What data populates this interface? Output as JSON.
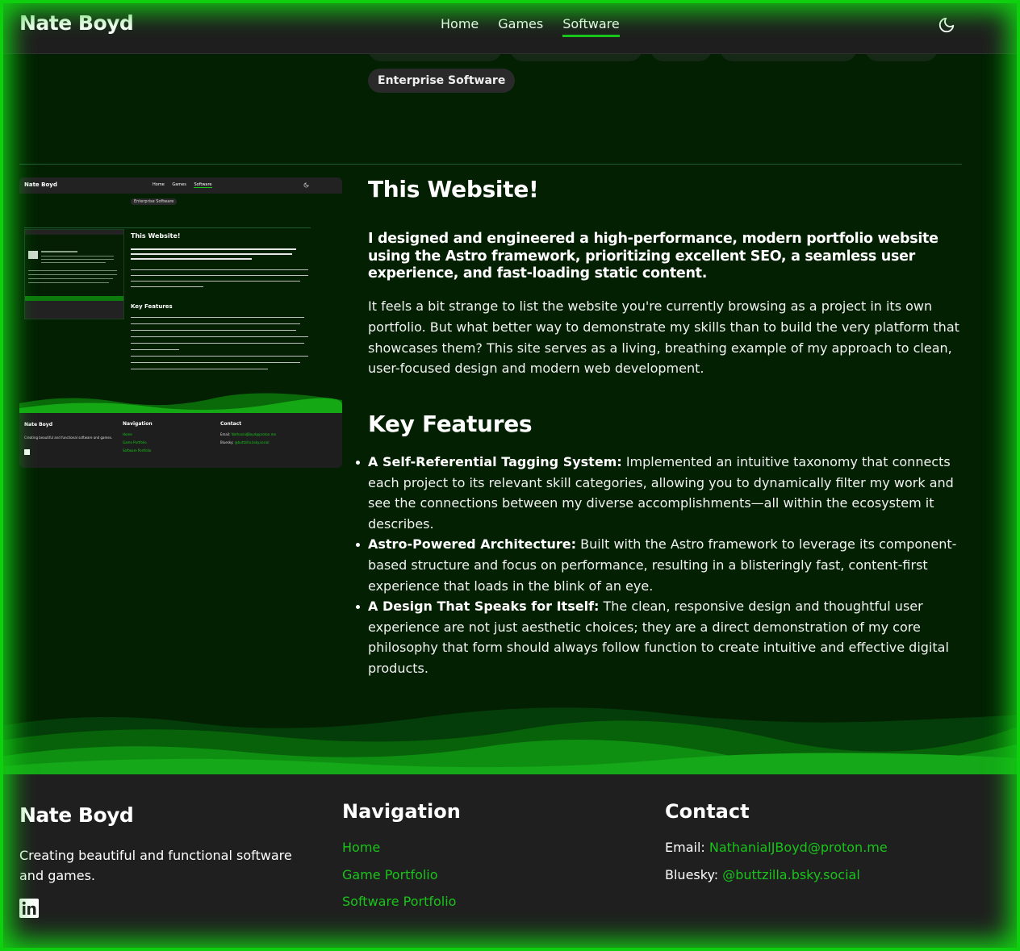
{
  "header": {
    "brand": "Nate Boyd",
    "nav": [
      {
        "label": "Home",
        "active": false
      },
      {
        "label": "Games",
        "active": false
      },
      {
        "label": "Software",
        "active": true
      }
    ],
    "theme_icon": "moon-icon"
  },
  "tags": {
    "visible": "Enterprise Software"
  },
  "project": {
    "title": "This Website!",
    "lead": "I designed and engineered a high-performance, modern portfolio website using the Astro framework, prioritizing excellent SEO, a seamless user experience, and fast-loading static content.",
    "description": "It feels a bit strange to list the website you're currently browsing as a project in its own portfolio. But what better way to demonstrate my skills than to build the very platform that showcases them? This site serves as a living, breathing example of my approach to clean, user-focused design and modern web development.",
    "features_heading": "Key Features",
    "features": [
      {
        "title": "A Self-Referential Tagging System:",
        "text": " Implemented an intuitive taxonomy that connects each project to its relevant skill categories, allowing you to dynamically filter my work and see the connections between my diverse accomplishments—all within the ecosystem it describes."
      },
      {
        "title": "Astro-Powered Architecture:",
        "text": " Built with the Astro framework to leverage its component-based structure and focus on performance, resulting in a blisteringly fast, content-first experience that loads in the blink of an eye."
      },
      {
        "title": "A Design That Speaks for Itself:",
        "text": " The clean, responsive design and thoughtful user experience are not just aesthetic choices; they are a direct demonstration of my core philosophy that form should always follow function to create intuitive and effective digital products."
      }
    ]
  },
  "thumbnail": {
    "brand": "Nate Boyd",
    "nav": [
      "Home",
      "Games",
      "Software"
    ],
    "tag": "Enterprise Software",
    "title": "This Website!",
    "features_heading": "Key Features",
    "footer_brand": "Nate Boyd",
    "footer_tagline": "Creating beautiful and functional software and games.",
    "footer_nav_heading": "Navigation",
    "footer_nav": [
      "Home",
      "Game Portfolio",
      "Software Portfolio"
    ],
    "footer_contact_heading": "Contact",
    "footer_email_label": "Email: ",
    "footer_email": "NathanialJBoyd@proton.me",
    "footer_bluesky_label": "Bluesky: ",
    "footer_bluesky": "@buttzilla.bsky.social"
  },
  "footer": {
    "brand": "Nate Boyd",
    "tagline": "Creating beautiful and functional software and games.",
    "social_icon": "linkedin-icon",
    "nav_heading": "Navigation",
    "nav": [
      "Home",
      "Game Portfolio",
      "Software Portfolio"
    ],
    "contact_heading": "Contact",
    "email_label": "Email: ",
    "email": "NathanialJBoyd@proton.me",
    "bluesky_label": "Bluesky: ",
    "bluesky": "@buttzilla.bsky.social"
  },
  "colors": {
    "accent": "#19c41a",
    "background": "#032003",
    "surface": "#1f1f1f"
  }
}
